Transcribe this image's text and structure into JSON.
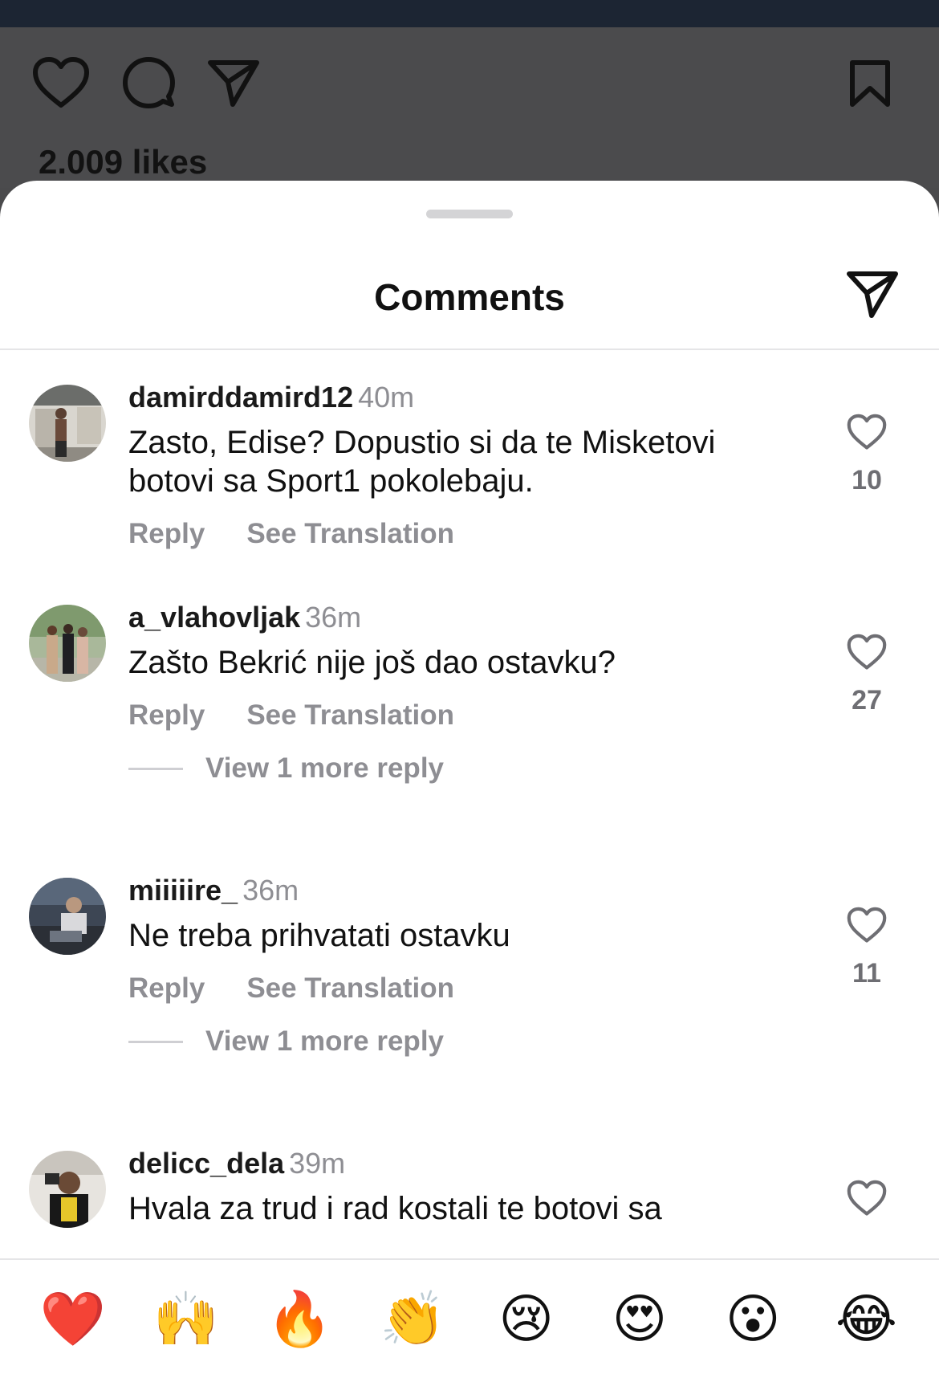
{
  "post": {
    "likes": "2.009 likes",
    "icons": [
      "heart-icon",
      "comment-icon",
      "share-icon",
      "bookmark-icon"
    ]
  },
  "sheet": {
    "title": "Comments"
  },
  "comments": [
    {
      "username": "damirddamird12",
      "time": "40m",
      "text": "Zasto, Edise? Dopustio si da te Misketovi botovi sa Sport1 pokolebaju.",
      "reply": "Reply",
      "translate": "See Translation",
      "likes": "10"
    },
    {
      "username": "a_vlahovljak",
      "time": "36m",
      "text": "Zašto Bekrić nije još dao ostavku?",
      "reply": "Reply",
      "translate": "See Translation",
      "likes": "27",
      "view_more": "View 1 more reply"
    },
    {
      "username": "miiiiire_",
      "time": "36m",
      "text": "Ne treba prihvatati ostavku",
      "reply": "Reply",
      "translate": "See Translation",
      "likes": "11",
      "view_more": "View 1 more reply"
    },
    {
      "username": "delicc_dela",
      "time": "39m",
      "text": "Hvala za trud i rad kostali te botovi sa"
    }
  ],
  "emoji_bar": [
    "❤️",
    "🙌",
    "🔥",
    "👏",
    "😢",
    "😍",
    "😮",
    "😂"
  ],
  "colors": {
    "sheet_bg": "#ffffff",
    "backdrop": "#4b4b4d",
    "secondary_text": "#8e8e93",
    "primary_text": "#111111"
  }
}
